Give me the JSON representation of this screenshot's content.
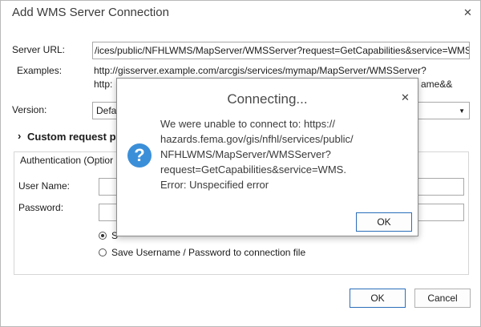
{
  "dialog": {
    "title": "Add WMS Server Connection",
    "close_glyph": "✕",
    "server_url_label": "Server URL:",
    "server_url_value": "/ices/public/NFHLWMS/MapServer/WMSServer?request=GetCapabilities&service=WMS",
    "examples_label": "Examples:",
    "example_1": "http://gisserver.example.com/arcgis/services/mymap/MapServer/WMSServer?",
    "example_2_start": "http:",
    "example_2_end": "ame&&",
    "version_label": "Version:",
    "version_value": "Defa",
    "custom_request_label": "Custom request pa",
    "custom_request_chevron": "›",
    "auth_label": "Authentication (Optior",
    "username_label": "User Name:",
    "password_label": "Password:",
    "radio_1_label": "S",
    "radio_2_label": "Save Username / Password to connection file",
    "ok_label": "OK",
    "cancel_label": "Cancel"
  },
  "modal": {
    "title": "Connecting...",
    "close_glyph": "✕",
    "icon_glyph": "?",
    "message_lines": [
      "We were unable to connect to: https://",
      "hazards.fema.gov/gis/nfhl/services/public/",
      "NFHLWMS/MapServer/WMSServer?",
      "request=GetCapabilities&service=WMS.",
      "Error: Unspecified error"
    ],
    "ok_label": "OK"
  }
}
